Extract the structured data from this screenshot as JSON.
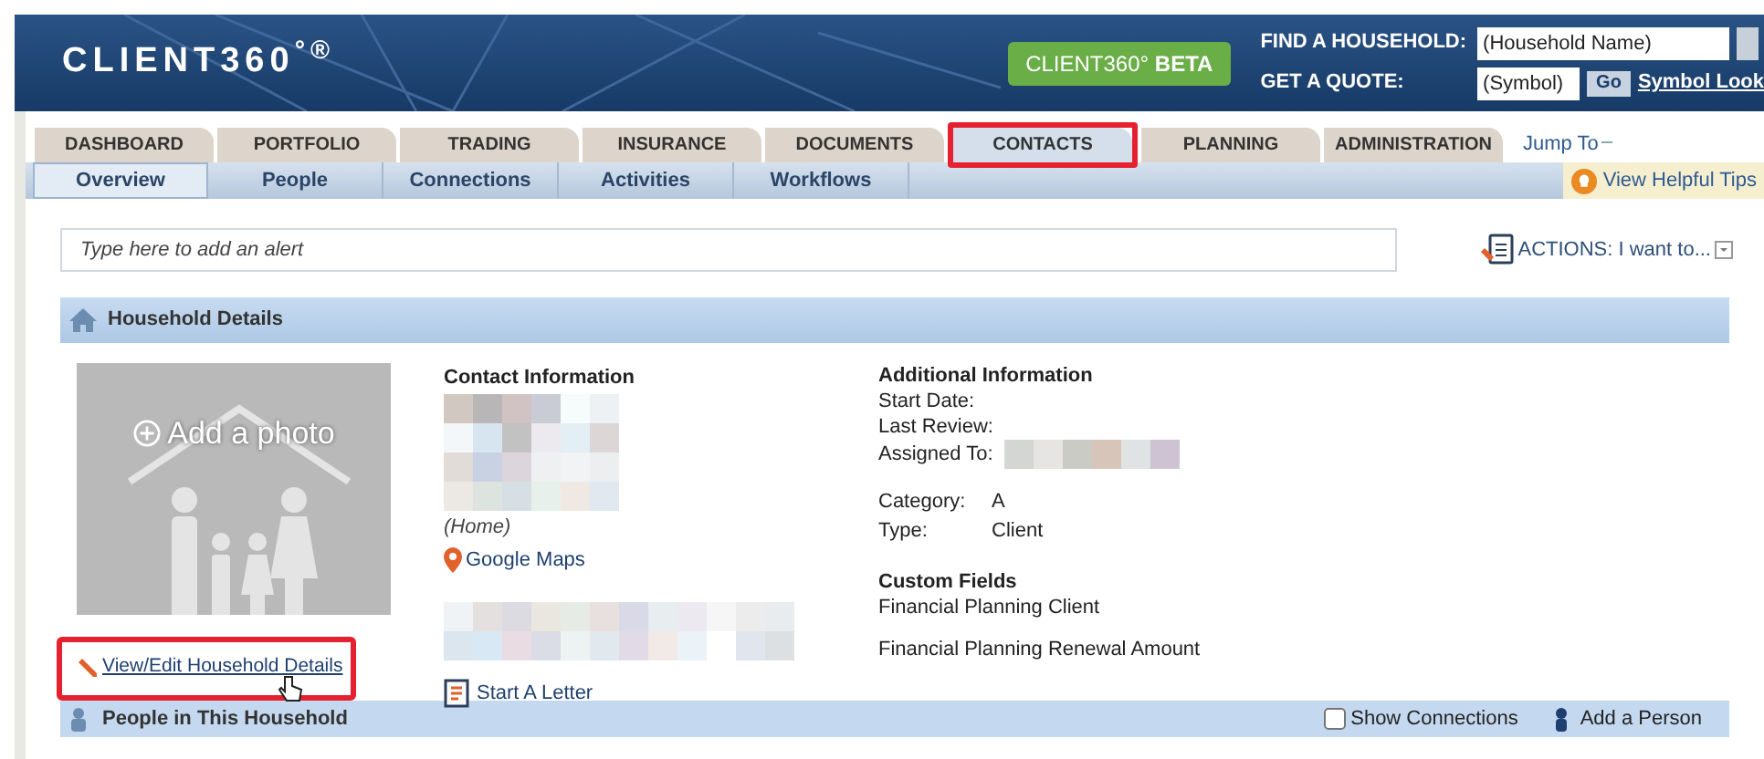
{
  "header": {
    "logo": "CLIENT360$^{°®}$",
    "beta_badge": "CLIENT360° **BETA**",
    "find_label": "FIND A HOUSEHOLD:",
    "find_placeholder": "(Household Name)",
    "quote_label": "GET A QUOTE:",
    "quote_placeholder": "(Symbol)",
    "go_button": "Go",
    "lookup_link": "Symbol Look"
  },
  "tabs": [
    {
      "label": "DASHBOARD",
      "selected": false
    },
    {
      "label": "PORTFOLIO",
      "selected": false
    },
    {
      "label": "TRADING",
      "selected": false
    },
    {
      "label": "INSURANCE",
      "selected": false
    },
    {
      "label": "DOCUMENTS",
      "selected": false
    },
    {
      "label": "CONTACTS",
      "selected": true,
      "highlighted": true
    },
    {
      "label": "PLANNING",
      "selected": false
    },
    {
      "label": "ADMINISTRATION",
      "selected": false
    }
  ],
  "jump_to": "Jump To",
  "subtabs": [
    {
      "label": "Overview",
      "selected": true
    },
    {
      "label": "People",
      "selected": false
    },
    {
      "label": "Connections",
      "selected": false
    },
    {
      "label": "Activities",
      "selected": false
    },
    {
      "label": "Workflows",
      "selected": false
    }
  ],
  "helpful_tips": "View Helpful Tips",
  "alert_field": {
    "placeholder": "Type here to add an alert"
  },
  "actions": "ACTIONS: I want to...",
  "household": {
    "title": "Household Details",
    "add_photo": "Add a photo",
    "contact": {
      "title": "Contact Information",
      "address_type": "(Home)",
      "maps_link": "Google Maps",
      "letter_link": "Start A Letter"
    },
    "additional": {
      "title": "Additional Information",
      "rows": [
        {
          "label": "Start Date:"
        },
        {
          "label": "Last Review:"
        },
        {
          "label": "Assigned To:"
        }
      ],
      "rows2": [
        {
          "label": "Category:",
          "value": "A"
        },
        {
          "label": "Type:",
          "value": "Client"
        }
      ]
    },
    "custom": {
      "title": "Custom Fields",
      "items": [
        "Financial Planning Client",
        "Financial Planning Renewal Amount"
      ]
    },
    "edit_link": {
      "label": "View/Edit Household Details",
      "highlighted": true
    }
  },
  "people_bar": {
    "title": "People in This Household",
    "show_connections": {
      "label": "Show Connections",
      "checked": false
    },
    "add_person": "Add a Person"
  }
}
